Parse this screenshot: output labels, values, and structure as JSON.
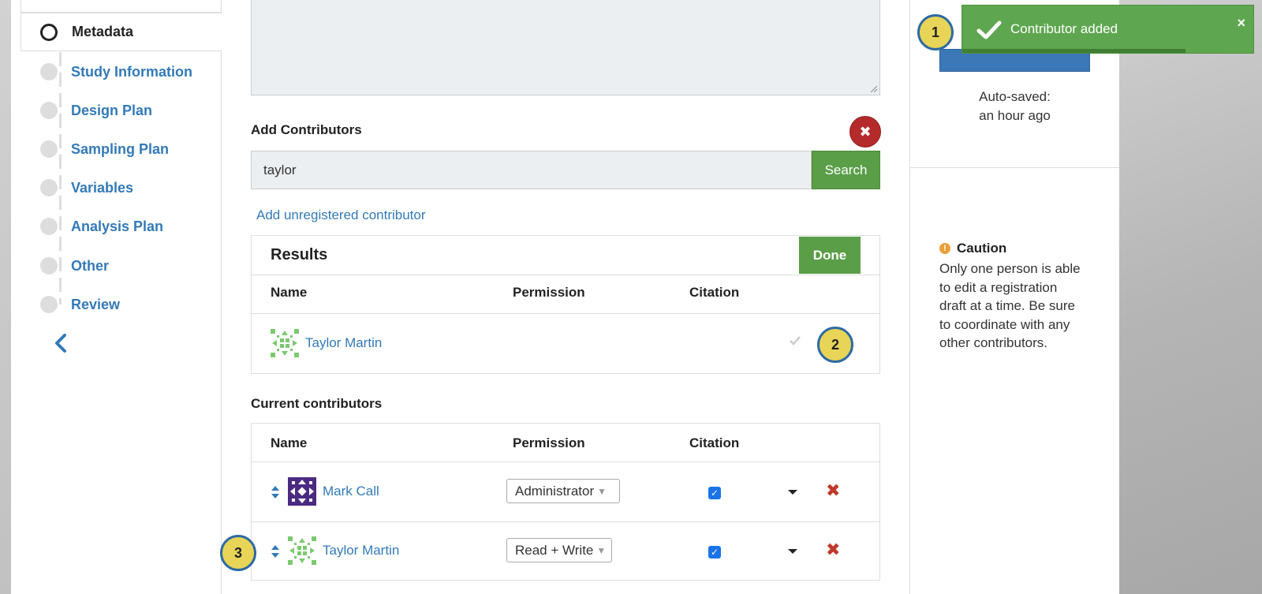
{
  "sidebar": {
    "active_item": "Metadata",
    "items": [
      {
        "label": "Study Information"
      },
      {
        "label": "Design Plan"
      },
      {
        "label": "Sampling Plan"
      },
      {
        "label": "Variables"
      },
      {
        "label": "Analysis Plan"
      },
      {
        "label": "Other"
      },
      {
        "label": "Review"
      }
    ],
    "back_icon": "chevron-left-icon"
  },
  "add_contributors": {
    "heading": "Add Contributors",
    "search_value": "taylor",
    "search_label": "Search",
    "unregistered_link": "Add unregistered contributor",
    "close_icon": "close-icon"
  },
  "results": {
    "title": "Results",
    "done_label": "Done",
    "columns": [
      "Name",
      "Permission",
      "Citation"
    ],
    "rows": [
      {
        "name": "Taylor Martin"
      }
    ]
  },
  "current": {
    "heading": "Current contributors",
    "columns": [
      "Name",
      "Permission",
      "Citation"
    ],
    "rows": [
      {
        "name": "Mark Call",
        "permission": "Administrator",
        "citation": true
      },
      {
        "name": "Taylor Martin",
        "permission": "Read + Write",
        "citation": true
      }
    ]
  },
  "right_panel": {
    "autosave_line1": "Auto-saved:",
    "autosave_line2": "an hour ago",
    "caution_title": "Caution",
    "caution_text": "Only one person is able to edit a registration draft at a time. Be sure to coordinate with any other contributors."
  },
  "toast": {
    "message": "Contributor added",
    "close": "×"
  },
  "badges": [
    "1",
    "2",
    "3"
  ],
  "colors": {
    "link": "#337ab7",
    "success": "#5a9e48",
    "danger": "#b52a2a",
    "badge": "#e8d557"
  }
}
